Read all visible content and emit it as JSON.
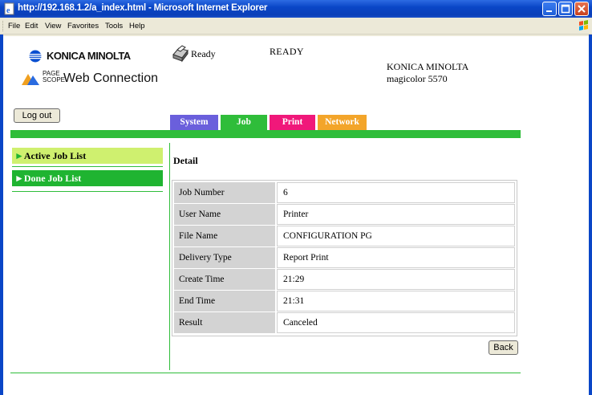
{
  "window": {
    "title": "http://192.168.1.2/a_index.html - Microsoft Internet Explorer",
    "icon": "ie-page-icon"
  },
  "menu": {
    "items": [
      "File",
      "Edit",
      "View",
      "Favorites",
      "Tools",
      "Help"
    ]
  },
  "header": {
    "brand_logo": "KONICA MINOLTA",
    "pagescope_small": "PAGE SCOPE",
    "pagescope_name": "Web Connection",
    "status_text": "Ready",
    "status_big": "READY",
    "printer_brand": "KONICA MINOLTA",
    "printer_model": "magicolor 5570",
    "logout_label": "Log out"
  },
  "tabs": [
    {
      "label": "System",
      "color": "#6a5fdc"
    },
    {
      "label": "Job",
      "color": "#2fbd3a"
    },
    {
      "label": "Print",
      "color": "#f0187a"
    },
    {
      "label": "Network",
      "color": "#f3a52a"
    }
  ],
  "sidebar": {
    "items": [
      {
        "label": "Active Job List",
        "state": "normal"
      },
      {
        "label": "Done Job List",
        "state": "selected"
      }
    ]
  },
  "detail": {
    "title": "Detail",
    "rows": [
      {
        "label": "Job Number",
        "value": "6"
      },
      {
        "label": "User Name",
        "value": "Printer"
      },
      {
        "label": "File Name",
        "value": "CONFIGURATION PG"
      },
      {
        "label": "Delivery Type",
        "value": "Report Print"
      },
      {
        "label": "Create Time",
        "value": "21:29"
      },
      {
        "label": "End Time",
        "value": "21:31"
      },
      {
        "label": "Result",
        "value": "Canceled"
      }
    ],
    "back_label": "Back"
  }
}
